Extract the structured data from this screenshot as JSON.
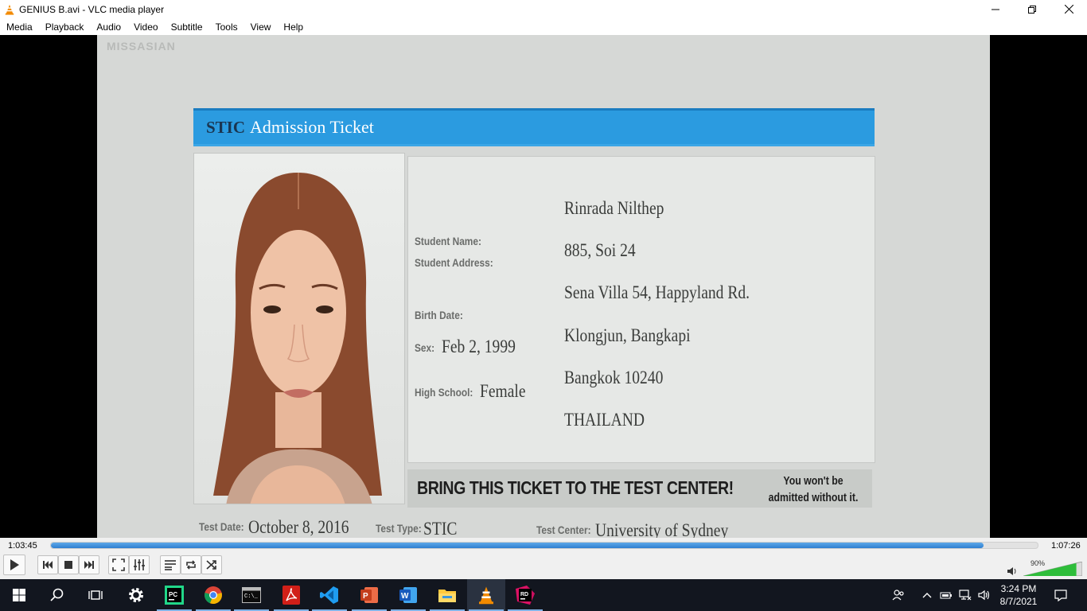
{
  "window": {
    "title": "GENIUS B.avi - VLC media player"
  },
  "menu": [
    "Media",
    "Playback",
    "Audio",
    "Video",
    "Subtitle",
    "Tools",
    "View",
    "Help"
  ],
  "video": {
    "watermark": "MISSASIAN",
    "ticket": {
      "brand": "STIC",
      "title": "Admission Ticket",
      "labels": {
        "student_name": "Student Name:",
        "student_address": "Student Address:",
        "birth_date": "Birth Date:",
        "sex": "Sex:",
        "high_school": "High School:",
        "test_date": "Test Date:",
        "test_type": "Test Type:",
        "test_center": "Test Center:"
      },
      "values": {
        "name": "Rinrada Nilthep",
        "address_1": "885, Soi 24",
        "address_2": "Sena Villa 54, Happyland Rd.",
        "address_3": "Klongjun, Bangkapi",
        "address_4": "Bangkok 10240",
        "address_5": "THAILAND",
        "birth_date": "Feb 2, 1999",
        "sex": "Female",
        "test_date": "October 8, 2016",
        "test_type": "STIC",
        "test_center": "University of Sydney"
      },
      "bring_notice": "BRING THIS TICKET TO THE TEST CENTER!",
      "warning_line1": "You won't be",
      "warning_line2": "admitted without it."
    }
  },
  "player": {
    "elapsed": "1:03:45",
    "total": "1:07:26",
    "progress": 0.945,
    "volume": "90%",
    "volume_level": 0.9,
    "buttons": [
      "play-icon",
      "previous-icon",
      "stop-icon",
      "next-icon",
      "fullscreen-icon",
      "extended-settings-icon",
      "playlist-icon",
      "loop-icon",
      "shuffle-icon",
      "speaker-icon"
    ]
  },
  "taskbar": {
    "apps": [
      "windows-start-icon",
      "search-icon",
      "task-view-icon",
      "settings-icon",
      "pycharm-icon",
      "chrome-icon",
      "terminal-icon",
      "acrobat-icon",
      "vscode-icon",
      "powerpoint-icon",
      "word-icon",
      "file-explorer-icon",
      "vlc-icon",
      "rider-icon"
    ],
    "time": "3:24 PM",
    "date": "8/7/2021"
  },
  "colors": {
    "ticket_blue": "#2b9be0",
    "seek_blue": "#2f7fd0",
    "volume_green": "#2ebd3a",
    "taskbar": "#12161f"
  }
}
